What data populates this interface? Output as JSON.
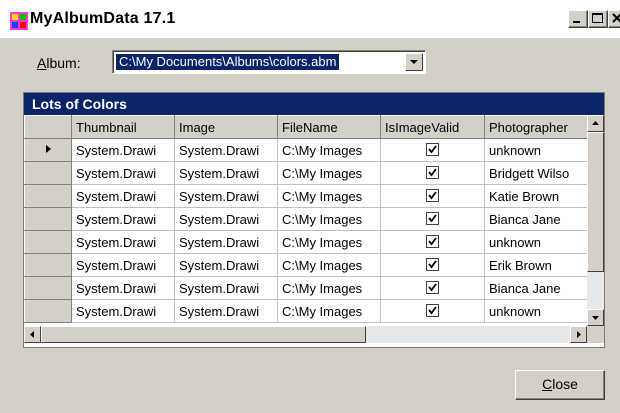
{
  "window": {
    "title": "MyAlbumData 17.1"
  },
  "album": {
    "label_first": "A",
    "label_rest": "lbum:",
    "value": "C:\\My Documents\\Albums\\colors.abm"
  },
  "grid": {
    "caption": "Lots of Colors",
    "columns": [
      "Thumbnail",
      "Image",
      "FileName",
      "IsImageValid",
      "Photographer"
    ],
    "rows": [
      {
        "thumbnail": "System.Drawi",
        "image": "System.Drawi",
        "filename": "C:\\My Images",
        "valid": true,
        "photographer": "unknown",
        "current": true
      },
      {
        "thumbnail": "System.Drawi",
        "image": "System.Drawi",
        "filename": "C:\\My Images",
        "valid": true,
        "photographer": "Bridgett Wilso",
        "current": false
      },
      {
        "thumbnail": "System.Drawi",
        "image": "System.Drawi",
        "filename": "C:\\My Images",
        "valid": true,
        "photographer": "Katie Brown",
        "current": false
      },
      {
        "thumbnail": "System.Drawi",
        "image": "System.Drawi",
        "filename": "C:\\My Images",
        "valid": true,
        "photographer": "Bianca Jane",
        "current": false
      },
      {
        "thumbnail": "System.Drawi",
        "image": "System.Drawi",
        "filename": "C:\\My Images",
        "valid": true,
        "photographer": "unknown",
        "current": false
      },
      {
        "thumbnail": "System.Drawi",
        "image": "System.Drawi",
        "filename": "C:\\My Images",
        "valid": true,
        "photographer": "Erik Brown",
        "current": false
      },
      {
        "thumbnail": "System.Drawi",
        "image": "System.Drawi",
        "filename": "C:\\My Images",
        "valid": true,
        "photographer": "Bianca Jane",
        "current": false
      },
      {
        "thumbnail": "System.Drawi",
        "image": "System.Drawi",
        "filename": "C:\\My Images",
        "valid": true,
        "photographer": "unknown",
        "current": false
      }
    ]
  },
  "buttons": {
    "close_first": "C",
    "close_rest": "lose"
  },
  "icons": {
    "app": "app-window-icon",
    "minimize": "minimize-icon",
    "maximize": "maximize-icon",
    "close": "close-icon",
    "dropdown": "chevron-down-icon",
    "current_row": "row-pointer-icon",
    "checkbox": "checkmark-icon"
  },
  "colors": {
    "face": "#d4d0c8",
    "selection": "#0a246a",
    "caption": "#0a246a"
  }
}
